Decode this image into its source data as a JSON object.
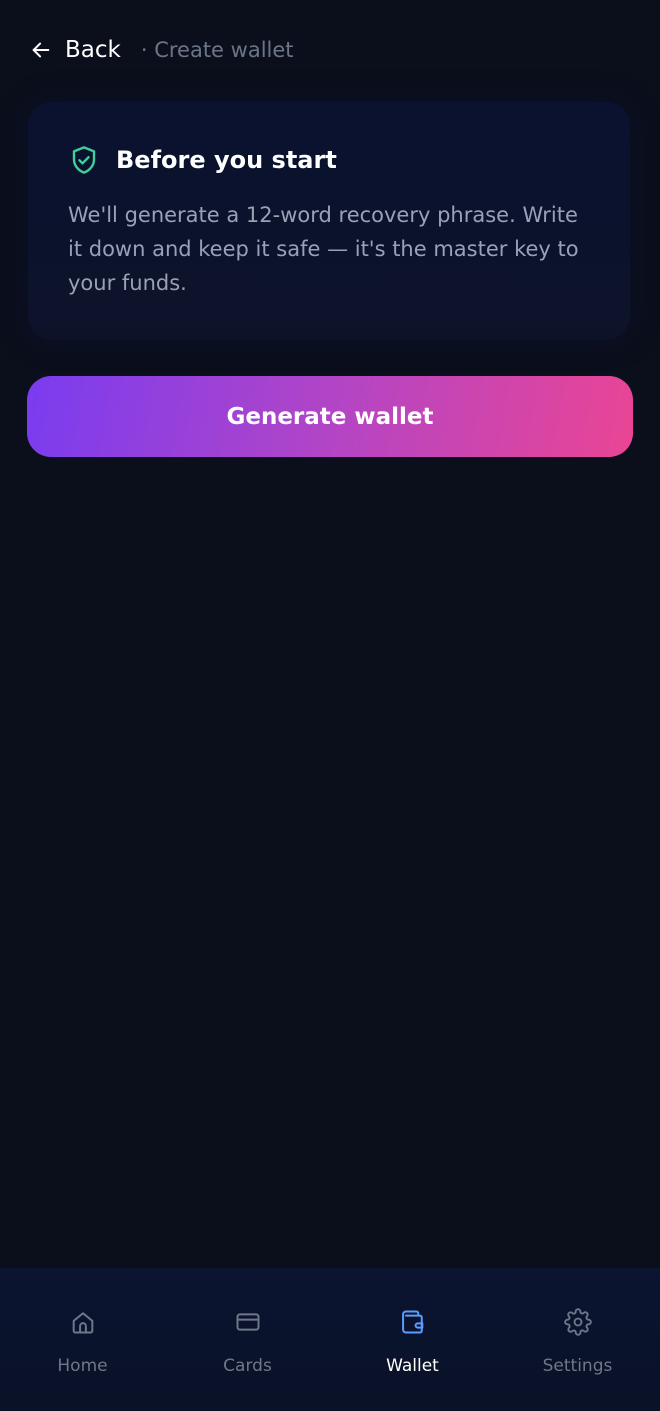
{
  "header": {
    "back_label": "Back",
    "breadcrumb": "· Create wallet"
  },
  "card": {
    "icon": "shield-check-icon",
    "title": "Before you start",
    "body": "We'll generate a 12-word recovery phrase. Write it down and keep it safe — it's the master key to your funds."
  },
  "primary_button": {
    "label": "Generate wallet"
  },
  "bottom_nav": {
    "items": [
      {
        "label": "Home",
        "icon": "home-icon",
        "active": false
      },
      {
        "label": "Cards",
        "icon": "card-icon",
        "active": false
      },
      {
        "label": "Wallet",
        "icon": "wallet-icon",
        "active": true
      },
      {
        "label": "Settings",
        "icon": "gear-icon",
        "active": false
      }
    ]
  },
  "colors": {
    "background": "#0b0f1c",
    "accent_start": "#7a3cf0",
    "accent_end": "#ea4594",
    "shield": "#3ecf9a",
    "nav_active_icon": "#5b9dff",
    "nav_inactive": "#6f7789"
  }
}
